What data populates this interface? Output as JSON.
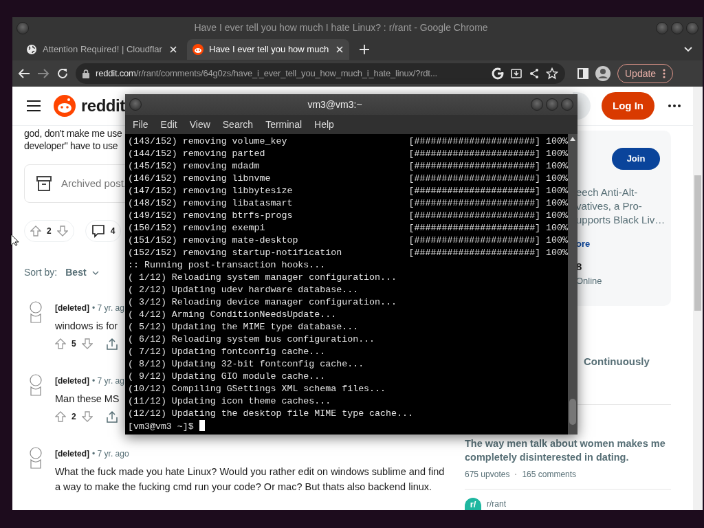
{
  "browser": {
    "title": "Have I ever tell you how much I hate Linux? : r/rant - Google Chrome",
    "tabs": [
      {
        "label": "Attention Required! | Cloudflar",
        "selected": false
      },
      {
        "label": "Have I ever tell you how much",
        "selected": true
      }
    ],
    "url_domain": "reddit.com",
    "url_path": "/r/rant/comments/64g0zs/have_i_ever_tell_you_how_much_i_hate_linux/?rdt...",
    "update_button": "Update"
  },
  "reddit": {
    "logo": "reddit",
    "login_button": "Log In",
    "post_text": [
      "god, don't make me use",
      "developer\" have to use"
    ],
    "archived": "Archived post.",
    "upvotes": "2",
    "comment_count": "4",
    "sort_label": "Sort by:",
    "sort_value": "Best",
    "comments": [
      {
        "author": "[deleted]",
        "age": "• 7 yr. ag",
        "text": "windows is for",
        "votes": "5"
      },
      {
        "author": "[deleted]",
        "age": "• 7 yr. ag",
        "text": "Man these MS",
        "votes": "2"
      },
      {
        "author": "[deleted]",
        "age": "• 7 yr. ago",
        "text": "What the fuck made you hate Linux? Would you rather edit on windows sublime and find a way to make the fucking cmd run your code? Or mac? But thats also backend linux."
      }
    ],
    "sidebar": {
      "join_button": "Join",
      "description": [
        "eech Anti-Alt-",
        "vatives, a Pro-",
        "upports Black Liv…"
      ],
      "more_link": "ore",
      "members": "8",
      "online": "Online",
      "heading": "Continuously",
      "related": {
        "title": "The way men talk about women makes me completely disinterested in dating.",
        "upvotes": "675 upvotes",
        "comments": "165 comments",
        "avatar": "r/",
        "subreddit": "r/rant"
      }
    }
  },
  "terminal": {
    "title": "vm3@vm3:~",
    "menu": [
      "File",
      "Edit",
      "View",
      "Search",
      "Terminal",
      "Help"
    ],
    "lines": [
      {
        "text": "(143/152) removing volume_key",
        "progress": "[######################] 100%"
      },
      {
        "text": "(144/152) removing parted",
        "progress": "[######################] 100%"
      },
      {
        "text": "(145/152) removing mdadm",
        "progress": "[######################] 100%"
      },
      {
        "text": "(146/152) removing libnvme",
        "progress": "[######################] 100%"
      },
      {
        "text": "(147/152) removing libbytesize",
        "progress": "[######################] 100%"
      },
      {
        "text": "(148/152) removing libatasmart",
        "progress": "[######################] 100%"
      },
      {
        "text": "(149/152) removing btrfs-progs",
        "progress": "[######################] 100%"
      },
      {
        "text": "(150/152) removing exempi",
        "progress": "[######################] 100%"
      },
      {
        "text": "(151/152) removing mate-desktop",
        "progress": "[######################] 100%"
      },
      {
        "text": "(152/152) removing startup-notification",
        "progress": "[######################] 100%"
      },
      {
        "text": ":: Running post-transaction hooks..."
      },
      {
        "text": "( 1/12) Reloading system manager configuration..."
      },
      {
        "text": "( 2/12) Updating udev hardware database..."
      },
      {
        "text": "( 3/12) Reloading device manager configuration..."
      },
      {
        "text": "( 4/12) Arming ConditionNeedsUpdate..."
      },
      {
        "text": "( 5/12) Updating the MIME type database..."
      },
      {
        "text": "( 6/12) Reloading system bus configuration..."
      },
      {
        "text": "( 7/12) Updating fontconfig cache..."
      },
      {
        "text": "( 8/12) Updating 32-bit fontconfig cache..."
      },
      {
        "text": "( 9/12) Updating GIO module cache..."
      },
      {
        "text": "(10/12) Compiling GSettings XML schema files..."
      },
      {
        "text": "(11/12) Updating icon theme caches..."
      },
      {
        "text": "(12/12) Updating the desktop file MIME type cache..."
      }
    ],
    "prompt": "[vm3@vm3 ~]$"
  }
}
